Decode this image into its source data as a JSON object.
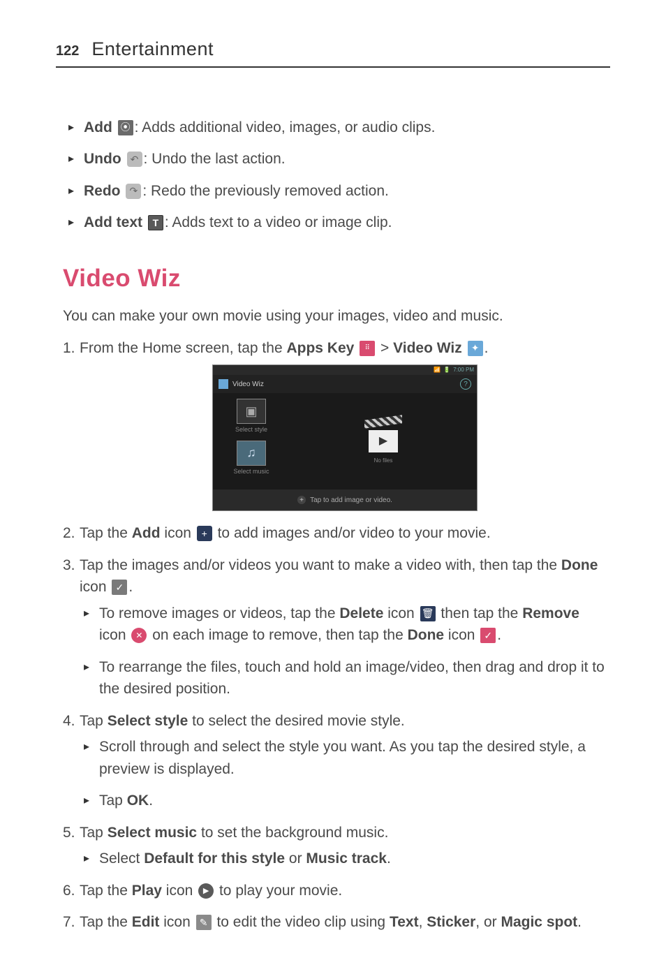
{
  "header": {
    "page_number": "122",
    "section": "Entertainment"
  },
  "top_bullets": [
    {
      "label": "Add",
      "icon": "add-clip-icon",
      "glyph": "⦿",
      "desc": ": Adds additional video, images, or audio clips."
    },
    {
      "label": "Undo",
      "icon": "undo-icon",
      "glyph": "↶",
      "desc": ": Undo the last action."
    },
    {
      "label": "Redo",
      "icon": "redo-icon",
      "glyph": "↷",
      "desc": ": Redo the previously removed action."
    },
    {
      "label": "Add text",
      "icon": "add-text-icon",
      "glyph": "T",
      "desc": ": Adds text to a video or image clip."
    }
  ],
  "heading": "Video Wiz",
  "intro": "You can make your own movie using your images, video and music.",
  "step1": {
    "num": "1.",
    "pre": "From the Home screen, tap the ",
    "apps_key": "Apps Key",
    "sep": " > ",
    "video_wiz": "Video Wiz",
    "end": "."
  },
  "screenshot": {
    "status_time": "7:00 PM",
    "title": "Video Wiz",
    "select_style": "Select style",
    "select_music": "Select music",
    "no_files": "No files",
    "footer": "Tap to add image or video."
  },
  "step2": {
    "num": "2.",
    "t1": "Tap the ",
    "add": "Add",
    "t2": " icon ",
    "t3": " to add images and/or video to your movie."
  },
  "step3": {
    "num": "3.",
    "t1": "Tap the images and/or videos you want to make a video with, then tap the ",
    "done": "Done",
    "t2": " icon ",
    "end": ".",
    "sub1": {
      "t1": "To remove images or videos, tap the ",
      "delete": "Delete",
      "t2": " icon ",
      "t3": " then tap the ",
      "remove": "Remove",
      "t4": " icon ",
      "t5": " on each image to remove, then tap the ",
      "done": "Done",
      "t6": " icon ",
      "end": "."
    },
    "sub2": "To rearrange the files, touch and hold an image/video, then drag and drop it to the desired position."
  },
  "step4": {
    "num": "4.",
    "t1": "Tap ",
    "select_style": "Select style",
    "t2": " to select the desired movie style.",
    "sub1": "Scroll through and select the style you want. As you tap the desired style, a preview is displayed.",
    "sub2_t1": "Tap ",
    "sub2_ok": "OK",
    "sub2_end": "."
  },
  "step5": {
    "num": "5.",
    "t1": "Tap ",
    "select_music": "Select music",
    "t2": " to set the background music.",
    "sub_t1": "Select ",
    "default": "Default for this style",
    "or": " or ",
    "music_track": "Music track",
    "end": "."
  },
  "step6": {
    "num": "6.",
    "t1": "Tap the ",
    "play": "Play",
    "t2": " icon ",
    "t3": " to play your movie."
  },
  "step7": {
    "num": "7.",
    "t1": "Tap the ",
    "edit": "Edit",
    "t2": " icon ",
    "t3": " to edit the video clip using ",
    "text": "Text",
    "c1": ", ",
    "sticker": "Sticker",
    "c2": ", or ",
    "magic_spot": "Magic spot",
    "end": "."
  }
}
